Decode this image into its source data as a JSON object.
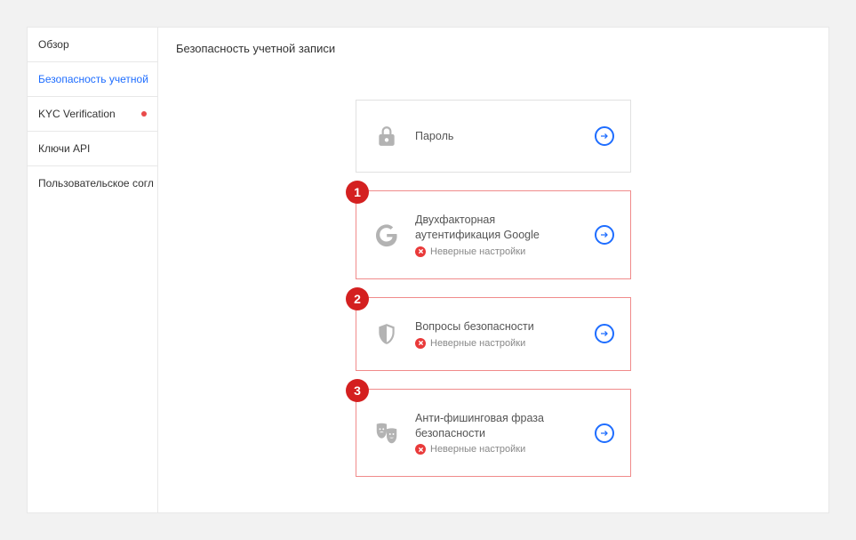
{
  "sidebar": {
    "items": [
      {
        "label": "Обзор"
      },
      {
        "label": "Безопасность учетной"
      },
      {
        "label": "KYC Verification"
      },
      {
        "label": "Ключи API"
      },
      {
        "label": "Пользовательское согл"
      }
    ]
  },
  "page": {
    "title": "Безопасность учетной записи"
  },
  "cards": [
    {
      "title": "Пароль"
    },
    {
      "badge": "1",
      "title": "Двухфакторная аутентификация Google",
      "status": "Неверные настройки"
    },
    {
      "badge": "2",
      "title": "Вопросы безопасности",
      "status": "Неверные настройки"
    },
    {
      "badge": "3",
      "title": "Анти-фишинговая фраза безопасности",
      "status": "Неверные настройки"
    }
  ]
}
